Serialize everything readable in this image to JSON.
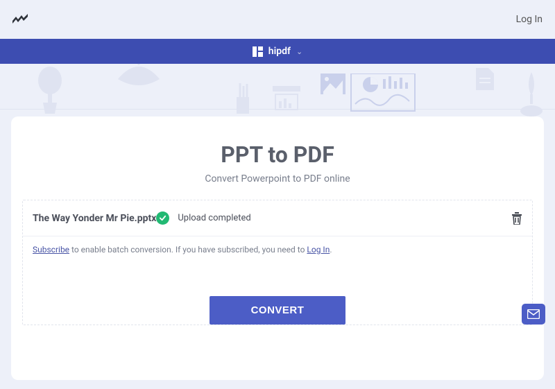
{
  "header": {
    "login_label": "Log In"
  },
  "brand": {
    "name": "hipdf"
  },
  "page": {
    "title": "PPT to PDF",
    "subtitle": "Convert Powerpoint to PDF online"
  },
  "file": {
    "name": "The Way Yonder Mr Pie.pptx",
    "status": "Upload completed"
  },
  "info": {
    "subscribe_label": "Subscribe",
    "text1": " to enable batch conversion. If you have subscribed, you need to ",
    "login_label": "Log In",
    "text2": "."
  },
  "actions": {
    "convert_label": "CONVERT"
  }
}
